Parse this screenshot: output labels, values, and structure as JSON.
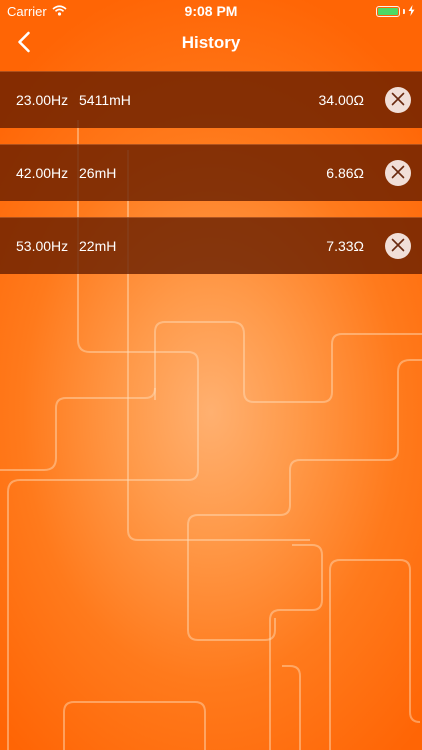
{
  "status_bar": {
    "carrier": "Carrier",
    "time": "9:08 PM",
    "battery_color": "#4cd964"
  },
  "nav": {
    "title": "History",
    "back_icon": "chevron-left-icon"
  },
  "history": {
    "rows": [
      {
        "frequency": "23.00Hz",
        "inductance": "5411mH",
        "impedance": "34.00Ω"
      },
      {
        "frequency": "42.00Hz",
        "inductance": "26mH",
        "impedance": "6.86Ω"
      },
      {
        "frequency": "53.00Hz",
        "inductance": "22mH",
        "impedance": "7.33Ω"
      }
    ],
    "delete_icon": "close-icon"
  },
  "theme": {
    "accent": "#ff6a00",
    "row_background": "#6a2400"
  }
}
